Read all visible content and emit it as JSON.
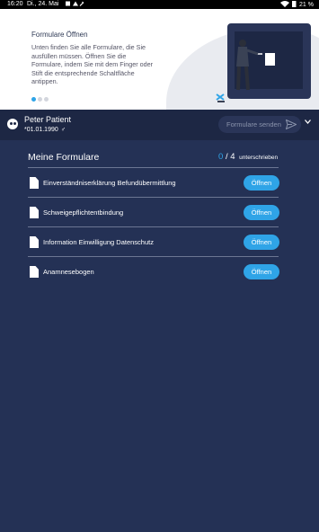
{
  "statusbar": {
    "time": "16:20",
    "date": "Di., 24. Mai",
    "battery": "21 %"
  },
  "banner": {
    "title": "Formulare Öffnen",
    "description": "Unten finden Sie alle Formulare, die Sie ausfüllen müssen. Öffnen Sie die Formulare, indem Sie mit dem Finger oder Stift die entsprechende Schaltfläche antippen.",
    "slides": 3,
    "active_slide": 1
  },
  "patient": {
    "name": "Peter Patient",
    "dob": "*01.01.1990",
    "gender_symbol": "♂"
  },
  "send_button": {
    "label": "Formulare senden"
  },
  "forms": {
    "title": "Meine Formulare",
    "signed": "0",
    "separator": "/",
    "total": "4",
    "signed_label": "unterschrieben",
    "items": [
      {
        "name": "Einverständniserklärung Befundübermittlung",
        "button": "Öffnen"
      },
      {
        "name": "Schweigepflichtentbindung",
        "button": "Öffnen"
      },
      {
        "name": "Information Einwilligung Datenschutz",
        "button": "Öffnen"
      },
      {
        "name": "Anamnesebogen",
        "button": "Öffnen"
      }
    ]
  },
  "colors": {
    "accent": "#2fa4e7",
    "background": "#243155",
    "header": "#1d2744"
  }
}
